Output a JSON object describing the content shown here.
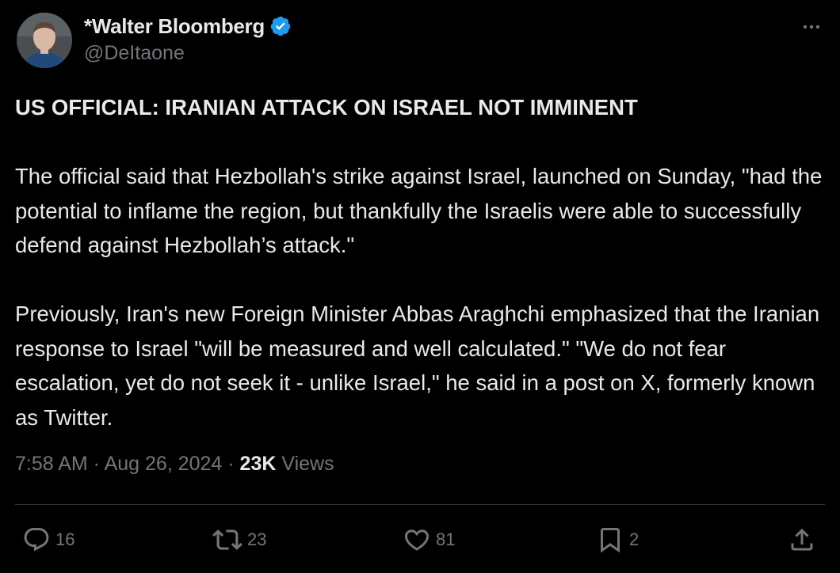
{
  "author": {
    "display_name": "*Walter Bloomberg",
    "handle": "@DeItaone",
    "verified_icon": "verified-badge-icon",
    "verified_color": "#1d9bf0"
  },
  "tweet": {
    "headline": "US OFFICIAL: IRANIAN ATTACK ON ISRAEL NOT IMMINENT",
    "paragraph_1": "The official said that Hezbollah's strike against Israel, launched on Sunday, \"had the potential to inflame the region, but thankfully the Israelis were able to successfully defend against Hezbollah’s attack.\"",
    "paragraph_2": "Previously, Iran's new Foreign Minister Abbas Araghchi emphasized that the Iranian response to Israel \"will be measured and well calculated.\" \"We do not fear escalation, yet do not seek it - unlike Israel,\" he said in a post on X, formerly known as Twitter."
  },
  "meta": {
    "time": "7:58 AM",
    "separator": " · ",
    "date": "Aug 26, 2024",
    "views_count": "23K",
    "views_label": " Views"
  },
  "actions": {
    "replies": "16",
    "reposts": "23",
    "likes": "81",
    "bookmarks": "2"
  },
  "colors": {
    "background": "#000000",
    "text_primary": "#e7e9ea",
    "text_secondary": "#71767b",
    "divider": "#2f3336",
    "accent": "#1d9bf0"
  }
}
